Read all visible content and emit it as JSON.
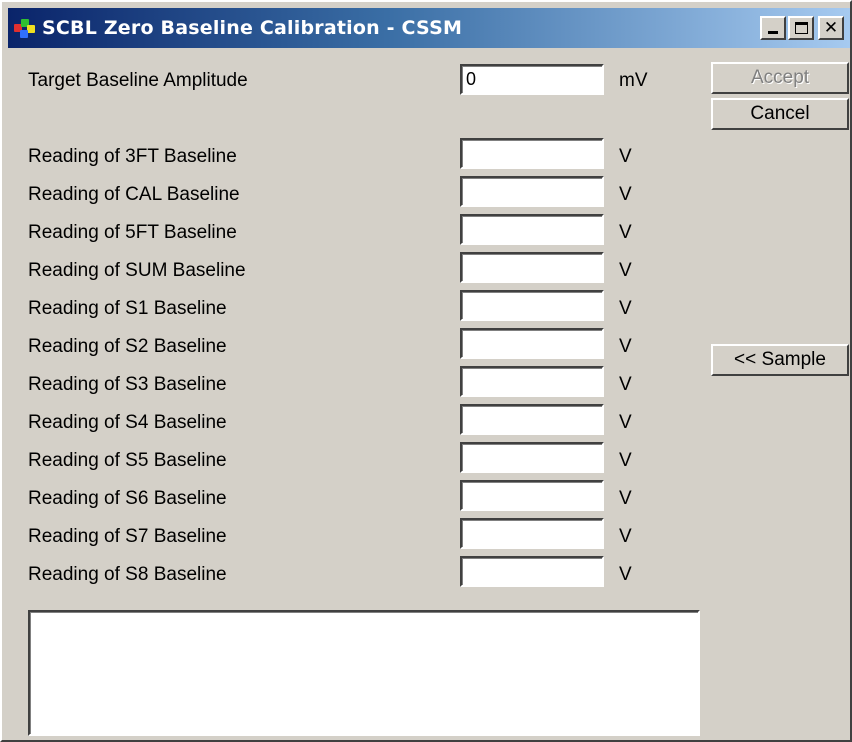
{
  "window": {
    "title": "SCBL Zero Baseline Calibration - CSSM",
    "minimize_label": "minimize",
    "maximize_label": "maximize",
    "close_glyph": "✕"
  },
  "target": {
    "label": "Target Baseline Amplitude",
    "value": "0",
    "unit": "mV"
  },
  "buttons": {
    "accept": "Accept",
    "cancel": "Cancel",
    "sample": "<< Sample"
  },
  "readings": [
    {
      "label": "Reading of 3FT Baseline",
      "value": "",
      "unit": "V"
    },
    {
      "label": "Reading of CAL Baseline",
      "value": "",
      "unit": "V"
    },
    {
      "label": "Reading of 5FT Baseline",
      "value": "",
      "unit": "V"
    },
    {
      "label": "Reading of SUM Baseline",
      "value": "",
      "unit": "V"
    },
    {
      "label": "Reading of S1 Baseline",
      "value": "",
      "unit": "V"
    },
    {
      "label": "Reading of S2 Baseline",
      "value": "",
      "unit": "V"
    },
    {
      "label": "Reading of S3 Baseline",
      "value": "",
      "unit": "V"
    },
    {
      "label": "Reading of S4 Baseline",
      "value": "",
      "unit": "V"
    },
    {
      "label": "Reading of S5 Baseline",
      "value": "",
      "unit": "V"
    },
    {
      "label": "Reading of S6 Baseline",
      "value": "",
      "unit": "V"
    },
    {
      "label": "Reading of S7 Baseline",
      "value": "",
      "unit": "V"
    },
    {
      "label": "Reading of S8 Baseline",
      "value": "",
      "unit": "V"
    }
  ],
  "memo": {
    "value": ""
  },
  "colors": {
    "title_gradient_start": "#0a246a",
    "title_gradient_end": "#a6caf0",
    "face": "#d4d0c8",
    "disabled_text": "#808080"
  },
  "icons": {
    "app": "app-logo-icon",
    "minimize": "minimize-icon",
    "maximize": "maximize-icon",
    "close": "close-icon"
  }
}
